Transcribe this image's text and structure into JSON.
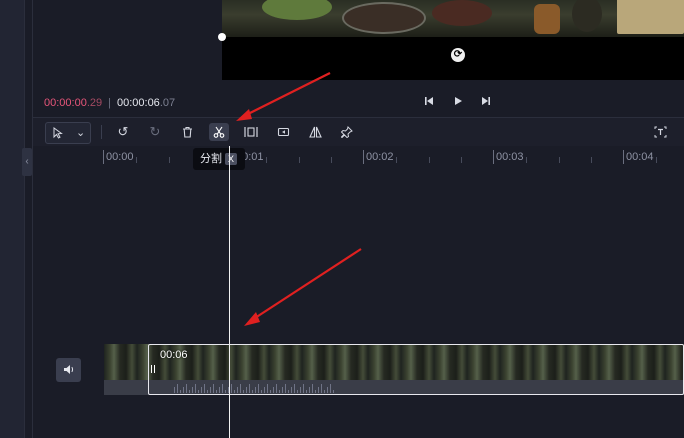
{
  "timecode": {
    "current_main": "00:00:00",
    "current_frac": ".29",
    "separator": "|",
    "total_main": "00:00:06",
    "total_frac": ".07"
  },
  "transport": {
    "prev_icon": "skip-back-icon",
    "play_icon": "play-icon",
    "next_icon": "skip-forward-icon"
  },
  "toolbar": {
    "tools": [
      "select-pointer-icon",
      "undo-icon",
      "redo-icon",
      "delete-icon",
      "split-scissors-icon",
      "freeze-frame-icon",
      "reverse-icon",
      "mirror-icon",
      "marker-pin-icon",
      "text-recognition-icon"
    ],
    "active_tool": "split-scissors-icon"
  },
  "tooltip": {
    "label": "分割",
    "shortcut": "X"
  },
  "ruler": {
    "labels": [
      "00:00",
      "00:01",
      "00:02",
      "00:03",
      "00:04"
    ]
  },
  "track": {
    "clip_duration": "00:06"
  },
  "colors": {
    "accent": "#e8557a",
    "annotation_arrow": "#e02020"
  }
}
